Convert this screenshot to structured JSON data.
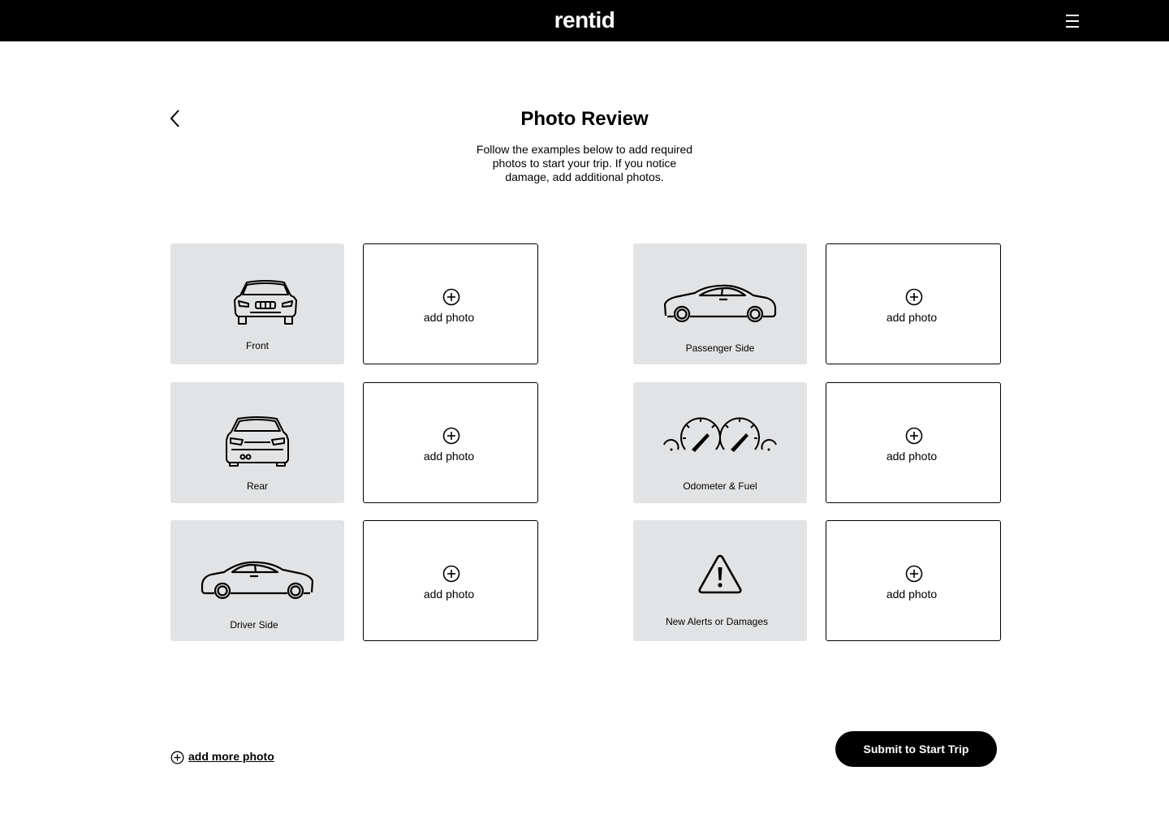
{
  "header": {
    "logo_text": "rentid",
    "menu_icon": "hamburger-menu-icon"
  },
  "page": {
    "back_icon": "chevron-left-icon",
    "title": "Photo Review",
    "subtitle": "Follow the examples below to add  required\nphotos to start your trip. If you notice\ndamage, add additional photos."
  },
  "photo_slots": [
    {
      "label": "Front",
      "icon": "car-front-icon",
      "add_label": "add photo"
    },
    {
      "label": "Passenger Side",
      "icon": "car-passenger-side-icon",
      "add_label": "add photo"
    },
    {
      "label": "Rear",
      "icon": "car-rear-icon",
      "add_label": "add photo"
    },
    {
      "label": "Odometer & Fuel",
      "icon": "gauges-icon",
      "add_label": "add photo"
    },
    {
      "label": "Driver Side",
      "icon": "car-driver-side-icon",
      "add_label": "add photo"
    },
    {
      "label": "New Alerts or Damages",
      "icon": "warning-icon",
      "add_label": "add photo"
    }
  ],
  "footer": {
    "add_more_label": "add more photo",
    "submit_label": "Submit to Start Trip"
  },
  "colors": {
    "topbar": "#000000",
    "example_bg": "#e2e3e4",
    "button": "#000000",
    "button_text": "#ffffff"
  }
}
